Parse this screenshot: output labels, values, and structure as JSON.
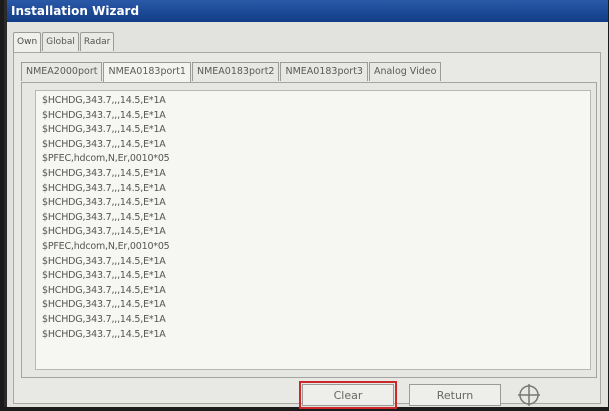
{
  "window": {
    "title": "Installation Wizard"
  },
  "top_tabs": [
    {
      "label": "Own"
    },
    {
      "label": "Global"
    },
    {
      "label": "Radar"
    }
  ],
  "sub_tabs": [
    {
      "label": "NMEA2000port"
    },
    {
      "label": "NMEA0183port1"
    },
    {
      "label": "NMEA0183port2"
    },
    {
      "label": "NMEA0183port3"
    },
    {
      "label": "Analog Video"
    }
  ],
  "log_lines": [
    "$HCHDG,343.7,,,14.5,E*1A",
    "$HCHDG,343.7,,,14.5,E*1A",
    "$HCHDG,343.7,,,14.5,E*1A",
    "$HCHDG,343.7,,,14.5,E*1A",
    "$PFEC,hdcom,N,Er,0010*05",
    "$HCHDG,343.7,,,14.5,E*1A",
    "$HCHDG,343.7,,,14.5,E*1A",
    "$HCHDG,343.7,,,14.5,E*1A",
    "$HCHDG,343.7,,,14.5,E*1A",
    "$HCHDG,343.7,,,14.5,E*1A",
    "$PFEC,hdcom,N,Er,0010*05",
    "$HCHDG,343.7,,,14.5,E*1A",
    "$HCHDG,343.7,,,14.5,E*1A",
    "$HCHDG,343.7,,,14.5,E*1A",
    "$HCHDG,343.7,,,14.5,E*1A",
    "$HCHDG,343.7,,,14.5,E*1A",
    "$HCHDG,343.7,,,14.5,E*1A"
  ],
  "buttons": {
    "clear": "Clear",
    "return": "Return"
  },
  "icons": {
    "cross": "crosshair-icon"
  },
  "colors": {
    "titlebar": "#1f4c99",
    "highlight": "#cc2a2a"
  }
}
